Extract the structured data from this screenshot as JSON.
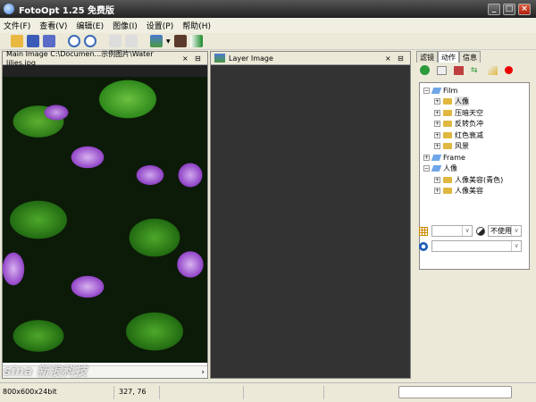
{
  "window": {
    "title": "FotoOpt 1.25 免费版",
    "min": "_",
    "max": "□",
    "close": "×"
  },
  "menu": [
    "文件(F)",
    "查看(V)",
    "编辑(E)",
    "图像(I)",
    "设置(P)",
    "帮助(H)"
  ],
  "left_panel": {
    "title": "Main Image C:\\Documen...示例图片\\Water lilies.jpg",
    "close": "×",
    "restore": "⊟"
  },
  "mid_panel": {
    "title": "Layer Image",
    "close": "×",
    "restore": "⊟"
  },
  "right_tabs": [
    "滤镜",
    "动作",
    "信息"
  ],
  "tree": [
    {
      "label": "Film",
      "level": 0,
      "type": "group",
      "sign": "−"
    },
    {
      "label": "人像",
      "level": 1,
      "type": "item",
      "sign": "+",
      "selected": true
    },
    {
      "label": "压暗天空",
      "level": 1,
      "type": "item",
      "sign": "+"
    },
    {
      "label": "反转负冲",
      "level": 1,
      "type": "item",
      "sign": "+"
    },
    {
      "label": "红色衰减",
      "level": 1,
      "type": "item",
      "sign": "+"
    },
    {
      "label": "风景",
      "level": 1,
      "type": "item",
      "sign": "+"
    },
    {
      "label": "Frame",
      "level": 0,
      "type": "group",
      "sign": "+"
    },
    {
      "label": "人像",
      "level": 0,
      "type": "group",
      "sign": "−"
    },
    {
      "label": "人像美容(青色)",
      "level": 1,
      "type": "item",
      "sign": "+"
    },
    {
      "label": "人像美容",
      "level": 1,
      "type": "item",
      "sign": "+"
    }
  ],
  "blend_mode": "不使用",
  "status": {
    "size": "800x600x24bit",
    "coords": "327, 76"
  },
  "watermark": "sina 新浪科技 tech.sina.com.cn",
  "scroll": {
    "left": "‹",
    "right": "›"
  }
}
